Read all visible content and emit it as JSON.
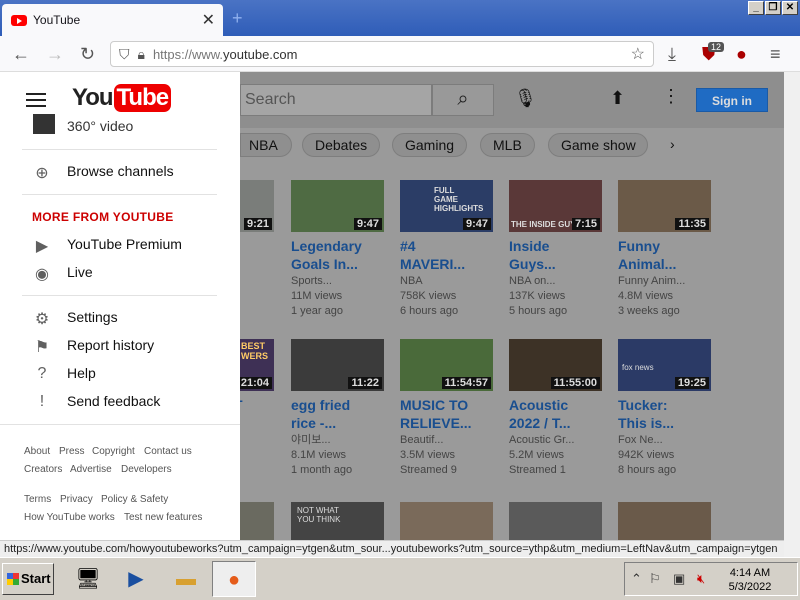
{
  "browser": {
    "tab_title": "YouTube",
    "tab_close": "✕",
    "new_tab": "+",
    "url_prefix": "https://www.",
    "url_domain": "youtube.com",
    "ext_badge": "12",
    "status_url": "https://www.youtube.com/howyoutubeworks?utm_campaign=ytgen&utm_sour...youtubeworks?utm_source=ythp&utm_medium=LeftNav&utm_campaign=ytgen"
  },
  "header": {
    "search_placeholder": "Search",
    "signin_label": "Sign in"
  },
  "chips": [
    "NBA",
    "Debates",
    "Gaming",
    "MLB",
    "Game show"
  ],
  "drawer": {
    "logo_you": "You",
    "logo_tube": "Tube",
    "partial_item": "360° video",
    "browse_channels": "Browse channels",
    "more_header": "MORE FROM YOUTUBE",
    "premium": "YouTube Premium",
    "live": "Live",
    "settings": "Settings",
    "report_history": "Report history",
    "help": "Help",
    "send_feedback": "Send feedback",
    "footer1": [
      "About",
      "Press",
      "Copyright",
      "Contact us"
    ],
    "footer2": [
      "Creators",
      "Advertise",
      "Developers"
    ],
    "footer3": [
      "Terms",
      "Privacy",
      "Policy & Safety"
    ],
    "footer4": [
      "How YouTube works",
      "Test new features"
    ]
  },
  "videos_row1": [
    {
      "duration": "9:21",
      "title": "",
      "channel": "",
      "views": "",
      "age": ""
    },
    {
      "duration": "9:47",
      "title": "Legendary Goals In...",
      "channel": "Sports...",
      "views": "11M views",
      "age": "1 year ago"
    },
    {
      "duration": "9:47",
      "title": "#4 MAVERI...",
      "channel": "NBA",
      "views": "758K views",
      "age": "6 hours ago",
      "thumb_text": "FULL GAME HIGHLIGHTS"
    },
    {
      "duration": "7:15",
      "title": "Inside Guys...",
      "channel": "NBA on...",
      "views": "137K views",
      "age": "5 hours ago",
      "thumb_text": "THE INSIDE GUYS"
    },
    {
      "duration": "11:35",
      "title": "Funny Animal...",
      "channel": "Funny Anim...",
      "views": "4.8M views",
      "age": "3 weeks ago"
    }
  ],
  "videos_row2": [
    {
      "duration": "21:04",
      "title": "T",
      "channel": "",
      "views": "",
      "age": "",
      "thumb_text": "BEST WERS"
    },
    {
      "duration": "11:22",
      "title": "egg fried rice -...",
      "channel": "야미보...",
      "views": "8.1M views",
      "age": "1 month ago"
    },
    {
      "duration": "11:54:57",
      "title": "MUSIC TO RELIEVE...",
      "channel": "Beautif...",
      "views": "3.5M views",
      "age": "Streamed 9"
    },
    {
      "duration": "11:55:00",
      "title": "Acoustic 2022 / T...",
      "channel": "Acoustic Gr...",
      "views": "5.2M views",
      "age": "Streamed 1"
    },
    {
      "duration": "19:25",
      "title": "Tucker: This is...",
      "channel": "Fox Ne...",
      "views": "942K views",
      "age": "8 hours ago",
      "thumb_text": "fox news"
    }
  ],
  "videos_row3": [
    {
      "thumb_text": "NOT WHAT YOU THINK"
    }
  ],
  "taskbar": {
    "start": "Start",
    "time": "4:14 AM",
    "date": "5/3/2022"
  }
}
